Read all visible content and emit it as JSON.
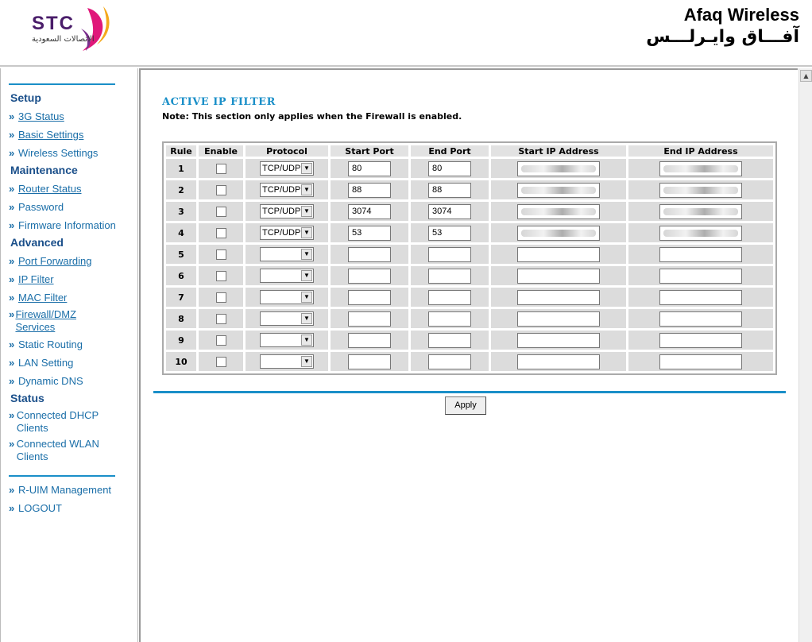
{
  "header": {
    "logo_text": "STC",
    "logo_subtext": "الاتصالات السعودية",
    "brand_en": "Afaq Wireless",
    "brand_ar": "آفـــاق وايـرلـــس"
  },
  "sidebar": {
    "sections": [
      {
        "title": "Setup",
        "items": [
          "3G Status",
          "Basic Settings",
          "Wireless Settings"
        ]
      },
      {
        "title": "Maintenance",
        "items": [
          "Router Status",
          "Password",
          "Firmware Information"
        ]
      },
      {
        "title": "Advanced",
        "items": [
          "Port Forwarding",
          "IP Filter",
          "MAC Filter",
          "Firewall/DMZ Services",
          "Static Routing",
          "LAN Setting",
          "Dynamic DNS"
        ]
      },
      {
        "title": "Status",
        "items": [
          "Connected DHCP Clients",
          "Connected WLAN Clients"
        ]
      }
    ],
    "extra": [
      "R-UIM Management",
      "LOGOUT"
    ]
  },
  "page": {
    "title": "ACTIVE IP FILTER",
    "note": "Note: This section only applies when the Firewall is enabled."
  },
  "table": {
    "headers": [
      "Rule",
      "Enable",
      "Protocol",
      "Start Port",
      "End Port",
      "Start IP Address",
      "End IP Address"
    ],
    "rows": [
      {
        "rule": "1",
        "protocol": "TCP/UDP",
        "start_port": "80",
        "end_port": "80"
      },
      {
        "rule": "2",
        "protocol": "TCP/UDP",
        "start_port": "88",
        "end_port": "88"
      },
      {
        "rule": "3",
        "protocol": "TCP/UDP",
        "start_port": "3074",
        "end_port": "3074"
      },
      {
        "rule": "4",
        "protocol": "TCP/UDP",
        "start_port": "53",
        "end_port": "53"
      },
      {
        "rule": "5",
        "protocol": "",
        "start_port": "",
        "end_port": ""
      },
      {
        "rule": "6",
        "protocol": "",
        "start_port": "",
        "end_port": ""
      },
      {
        "rule": "7",
        "protocol": "",
        "start_port": "",
        "end_port": ""
      },
      {
        "rule": "8",
        "protocol": "",
        "start_port": "",
        "end_port": ""
      },
      {
        "rule": "9",
        "protocol": "",
        "start_port": "",
        "end_port": ""
      },
      {
        "rule": "10",
        "protocol": "",
        "start_port": "",
        "end_port": ""
      }
    ]
  },
  "apply_label": "Apply",
  "colors": {
    "accent": "#1a8fc8",
    "nav_text": "#1a6ea8",
    "nav_head": "#1a4f8a"
  }
}
